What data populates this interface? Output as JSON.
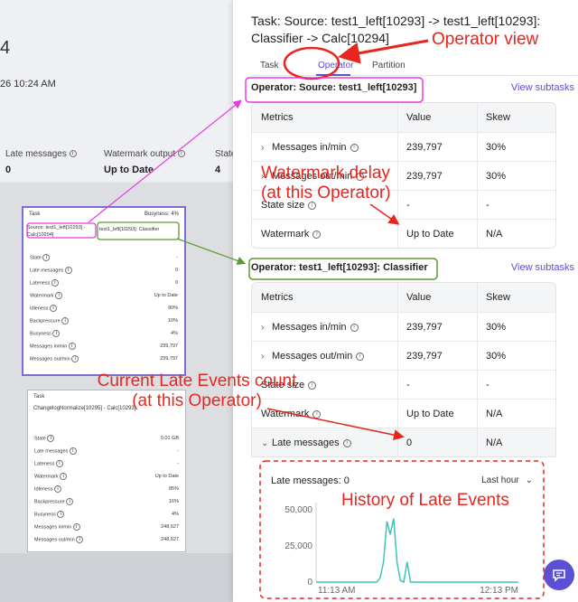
{
  "background": {
    "big_number": "4",
    "date": "26 10:24 AM",
    "metrics": [
      {
        "label": "Late messages",
        "value": "0"
      },
      {
        "label": "Watermark output",
        "value": "Up to Date"
      },
      {
        "label": "State",
        "value": "4"
      }
    ],
    "node1": {
      "header": "Task",
      "busyness": "Busyness: 4%",
      "source_label": "Source: test1_left[10293] - Calc[10294]",
      "classifier_label": "test1_left[10293]: Classifier",
      "rows": [
        {
          "k": "State",
          "v": "-"
        },
        {
          "k": "Late messages",
          "v": "0"
        },
        {
          "k": "Lateness",
          "v": "0"
        },
        {
          "k": "Watermark",
          "v": "Up to Date"
        },
        {
          "k": "Idleness",
          "v": "90%"
        },
        {
          "k": "Backpressure",
          "v": "10%"
        },
        {
          "k": "Busyness",
          "v": "4%"
        },
        {
          "k": "Messages in/min",
          "v": "239,797"
        },
        {
          "k": "Messages out/min",
          "v": "239,797"
        }
      ]
    },
    "node2": {
      "header": "Task",
      "title": "ChangelogNormalize[10295] - Calc[10293]",
      "rows": [
        {
          "k": "State",
          "v": "0.01 GB"
        },
        {
          "k": "Late messages",
          "v": "-"
        },
        {
          "k": "Lateness",
          "v": "-"
        },
        {
          "k": "Watermark",
          "v": "Up to Date"
        },
        {
          "k": "Idleness",
          "v": "85%"
        },
        {
          "k": "Backpressure",
          "v": "16%"
        },
        {
          "k": "Busyness",
          "v": "4%"
        },
        {
          "k": "Messages in/min",
          "v": "248,627"
        },
        {
          "k": "Messages out/min",
          "v": "248,627"
        }
      ]
    }
  },
  "panel": {
    "title": "Task: Source: test1_left[10293] -> test1_left[10293]: Classifier -> Calc[10294]",
    "tabs": [
      "Task",
      "Operator",
      "Partition"
    ],
    "active_tab": "Operator",
    "operator1": {
      "title": "Operator: Source: test1_left[10293]",
      "link": "View subtasks",
      "headers": [
        "Metrics",
        "Value",
        "Skew"
      ],
      "rows": [
        {
          "metric": "Messages in/min",
          "value": "239,797",
          "skew": "30%",
          "chevron": true
        },
        {
          "metric": "Messages out/min",
          "value": "239,797",
          "skew": "30%",
          "chevron": true
        },
        {
          "metric": "State size",
          "value": "-",
          "skew": "-",
          "chevron": false
        },
        {
          "metric": "Watermark",
          "value": "Up to Date",
          "skew": "N/A",
          "chevron": false
        }
      ]
    },
    "operator2": {
      "title": "Operator: test1_left[10293]: Classifier",
      "link": "View subtasks",
      "headers": [
        "Metrics",
        "Value",
        "Skew"
      ],
      "rows": [
        {
          "metric": "Messages in/min",
          "value": "239,797",
          "skew": "30%",
          "chevron": true
        },
        {
          "metric": "Messages out/min",
          "value": "239,797",
          "skew": "30%",
          "chevron": true
        },
        {
          "metric": "State size",
          "value": "-",
          "skew": "-",
          "chevron": false
        },
        {
          "metric": "Watermark",
          "value": "Up to Date",
          "skew": "N/A",
          "chevron": false
        },
        {
          "metric": "Late messages",
          "value": "0",
          "skew": "N/A",
          "chevron": true
        }
      ]
    },
    "late_chart": {
      "label": "Late messages: 0",
      "range": "Last hour"
    }
  },
  "annotations": {
    "operator_view": "Operator view",
    "watermark_delay": [
      "Watermark delay",
      "(at this Operator)"
    ],
    "late_count": [
      "Current Late Events count",
      "(at this Operator)"
    ],
    "history": "History of Late Events"
  },
  "colors": {
    "accent": "#5b4fd3",
    "annotation_red": "#e8251e",
    "annotation_magenta": "#e63be3",
    "annotation_green": "#5b9a34",
    "series": "#3fc4b8"
  },
  "icons": [
    "info-icon",
    "chevron-right-icon",
    "chevron-down-icon",
    "chat-icon"
  ],
  "chart_data": {
    "type": "line",
    "title": "",
    "xlabel": "",
    "ylabel": "",
    "x_ticks": [
      "11:13 AM",
      "12:13 PM"
    ],
    "y_ticks": [
      0,
      25000,
      50000
    ],
    "y_tick_labels": [
      "0",
      "25,000",
      "50,000"
    ],
    "ylim": [
      0,
      55000
    ],
    "grid": false,
    "series": [
      {
        "x": [
          0,
          10,
          15,
          18,
          19,
          20,
          21,
          22,
          23,
          24,
          25,
          26,
          27,
          28,
          29,
          30,
          60
        ],
        "y": [
          0,
          0,
          0,
          0,
          3000,
          14000,
          42000,
          33000,
          44000,
          14000,
          1000,
          0,
          14000,
          0,
          0,
          0,
          0
        ]
      }
    ]
  }
}
